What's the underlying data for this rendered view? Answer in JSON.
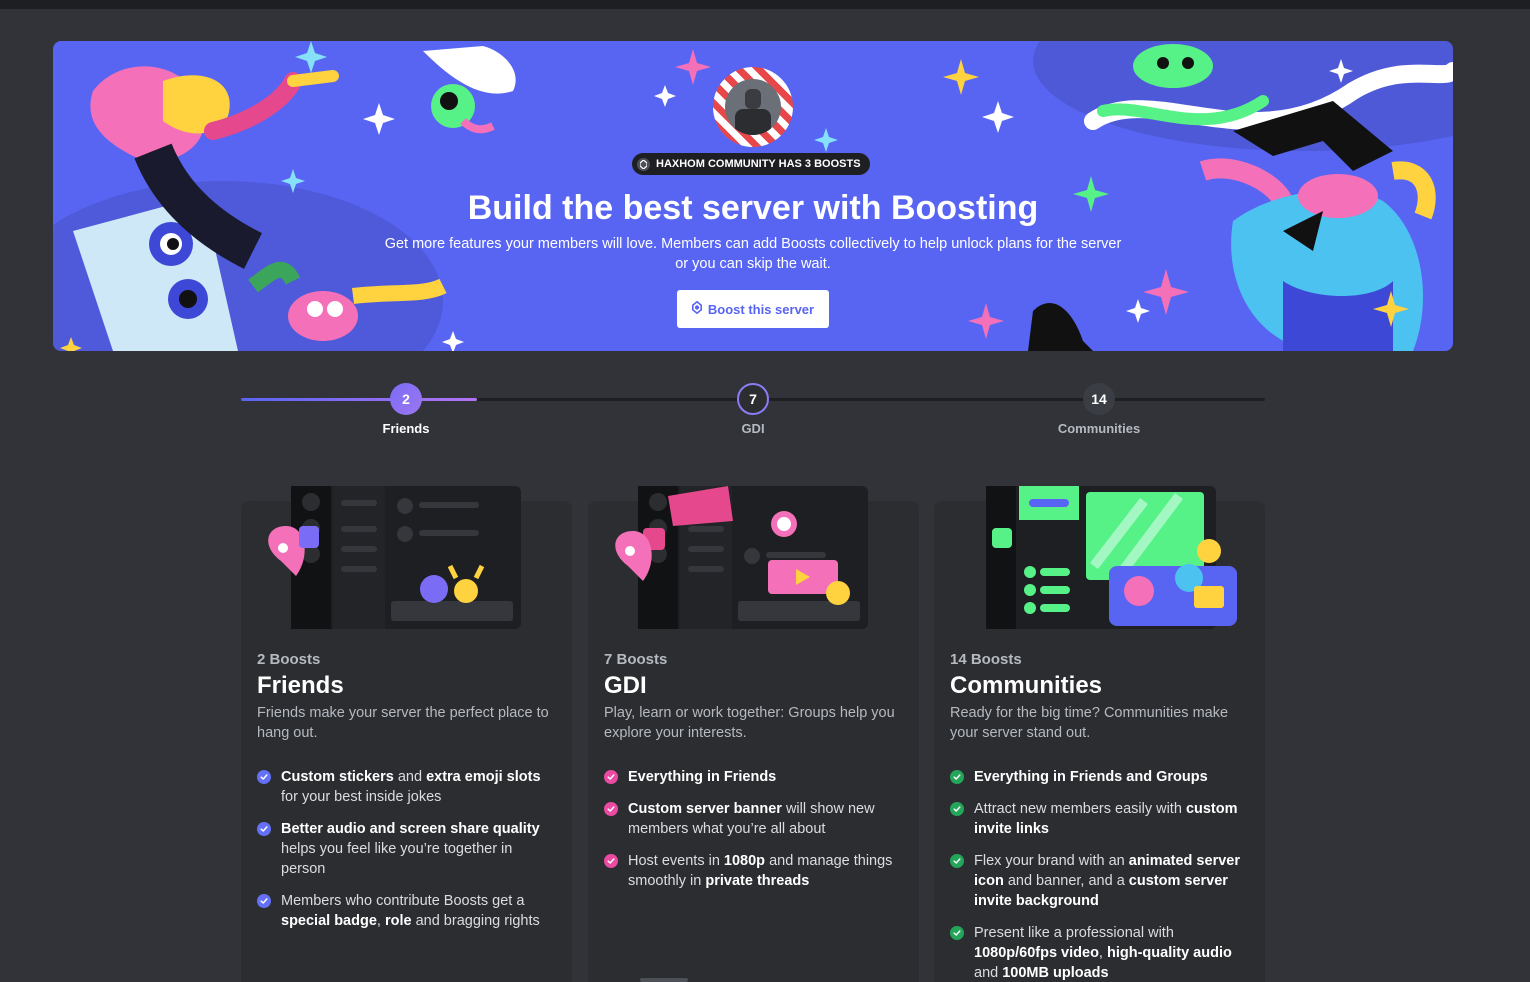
{
  "banner": {
    "pill_text": "HAXHOM COMMUNITY HAS 3 BOOSTS",
    "title": "Build the best server with Boosting",
    "subtitle": "Get more features your members will love. Members can add Boosts collectively to help unlock plans for the server or you can skip the wait.",
    "button_label": "Boost this server"
  },
  "progress": {
    "fraction_filled": 0.23,
    "nodes": [
      {
        "value": "2",
        "label": "Friends"
      },
      {
        "value": "7",
        "label": "GDI"
      },
      {
        "value": "14",
        "label": "Communities"
      }
    ]
  },
  "tiers": [
    {
      "boosts": "2 Boosts",
      "name": "Friends",
      "desc": "Friends make your server the perfect place to hang out.",
      "check_color": "#6470f5",
      "features": [
        [
          {
            "b": true,
            "t": "Custom stickers"
          },
          {
            "b": false,
            "t": " and "
          },
          {
            "b": true,
            "t": "extra emoji slots"
          },
          {
            "b": false,
            "t": " for your best inside jokes"
          }
        ],
        [
          {
            "b": true,
            "t": "Better audio and screen share quality"
          },
          {
            "b": false,
            "t": " helps you feel like you’re together in person"
          }
        ],
        [
          {
            "b": false,
            "t": "Members who contribute Boosts get a "
          },
          {
            "b": true,
            "t": "special badge"
          },
          {
            "b": false,
            "t": ", "
          },
          {
            "b": true,
            "t": "role"
          },
          {
            "b": false,
            "t": " and bragging rights"
          }
        ]
      ]
    },
    {
      "boosts": "7 Boosts",
      "name": "GDI",
      "desc": "Play, learn or work together: Groups help you explore your interests.",
      "check_color": "#ea4aa2",
      "features": [
        [
          {
            "b": true,
            "t": "Everything in Friends"
          }
        ],
        [
          {
            "b": true,
            "t": "Custom server banner"
          },
          {
            "b": false,
            "t": " will show new members what you’re all about"
          }
        ],
        [
          {
            "b": false,
            "t": "Host events in "
          },
          {
            "b": true,
            "t": "1080p"
          },
          {
            "b": false,
            "t": " and manage things smoothly in "
          },
          {
            "b": true,
            "t": "private threads"
          }
        ]
      ]
    },
    {
      "boosts": "14 Boosts",
      "name": "Communities",
      "desc": "Ready for the big time? Communities make your server stand out.",
      "check_color": "#23a55a",
      "features": [
        [
          {
            "b": true,
            "t": "Everything in Friends and Groups"
          }
        ],
        [
          {
            "b": false,
            "t": "Attract new members easily with "
          },
          {
            "b": true,
            "t": "custom invite links"
          }
        ],
        [
          {
            "b": false,
            "t": "Flex your brand with an "
          },
          {
            "b": true,
            "t": "animated server icon"
          },
          {
            "b": false,
            "t": " and banner, and a "
          },
          {
            "b": true,
            "t": "custom server invite background"
          }
        ],
        [
          {
            "b": false,
            "t": "Present like a professional with "
          },
          {
            "b": true,
            "t": "1080p/60fps video"
          },
          {
            "b": false,
            "t": ", "
          },
          {
            "b": true,
            "t": "high-quality audio"
          },
          {
            "b": false,
            "t": " and "
          },
          {
            "b": true,
            "t": "100MB uploads"
          }
        ]
      ]
    }
  ]
}
